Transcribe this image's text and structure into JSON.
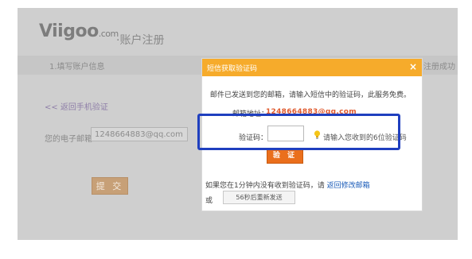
{
  "page": {
    "logo_text": "Viigoo",
    "logo_suffix": ".com",
    "title": "·账户注册"
  },
  "steps": {
    "step1": "1.填写账户信息",
    "step3": "注册成功"
  },
  "form": {
    "back_link": "<< 返回手机验证",
    "email_label": "您的电子邮箱:",
    "email_value": "1248664883@qq.com",
    "submit_label": "提 交"
  },
  "modal": {
    "title": "短信获取验证码",
    "close_label": "×",
    "notice": "邮件已发送到您的邮箱，请输入短信中的验证码，此服务免费。",
    "email_label": "邮箱地址：",
    "email_value": "1248664883@qq.com",
    "code_label": "验证码：",
    "code_value": "",
    "code_hint": "请输入您收到的6位验证码",
    "verify_label": "验 证",
    "help_prefix": "如果您在1分钟内没有收到验证码，请",
    "help_link": "返回修改邮箱",
    "or_text": "或",
    "resend_label": "56秒后重新发送"
  },
  "colors": {
    "header_orange": "#f6ab2b",
    "verify_orange": "#ea6f1c",
    "highlight_blue": "#1f3fbf",
    "link_blue": "#1a5bb8"
  },
  "icons": {
    "hint": "lightbulb-icon",
    "close": "close-icon"
  }
}
